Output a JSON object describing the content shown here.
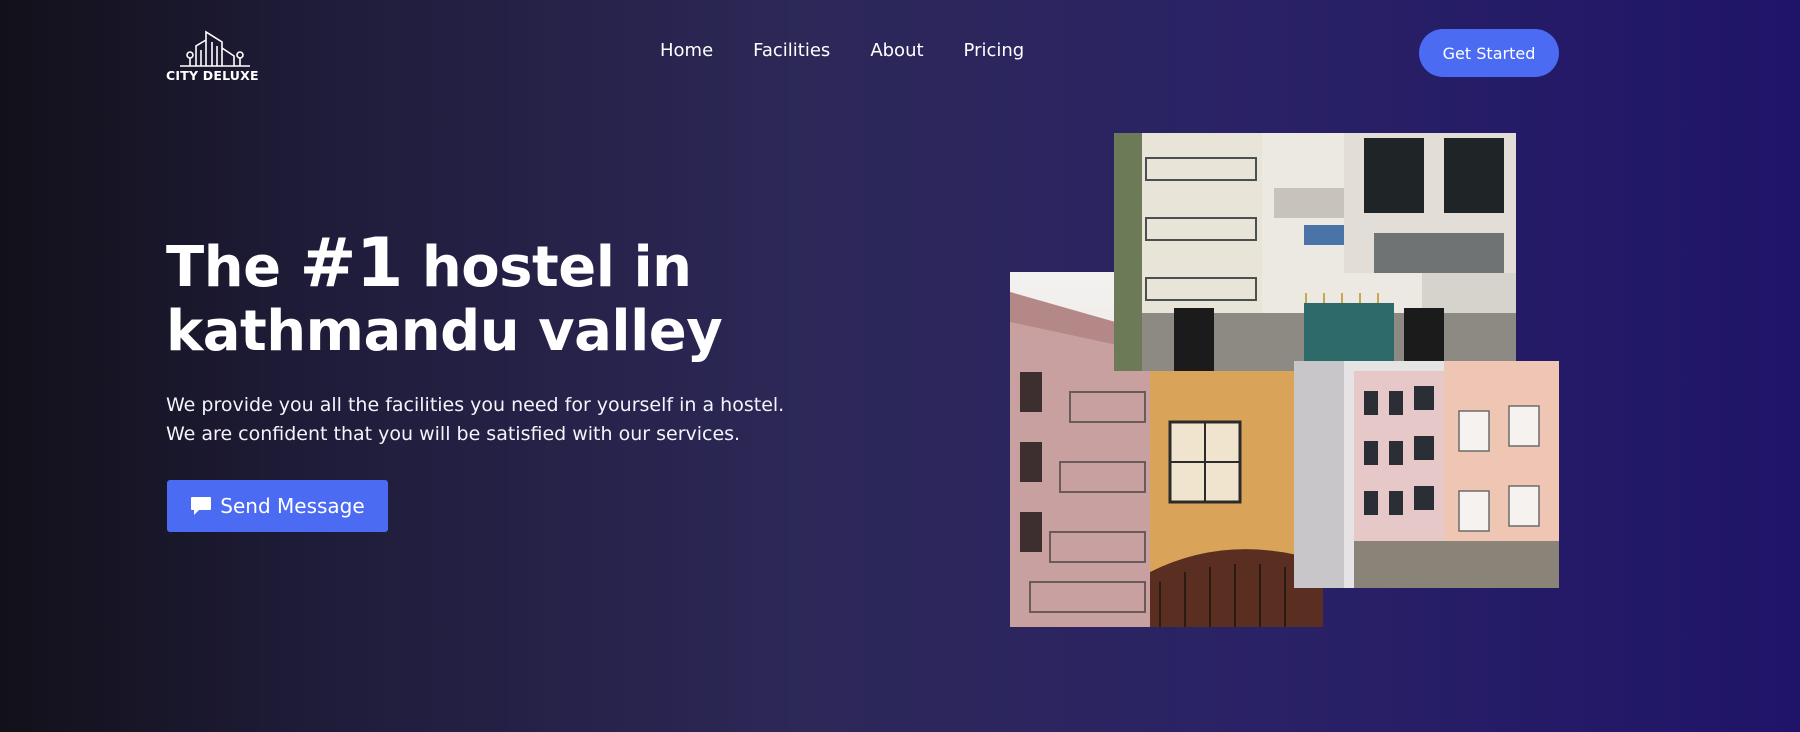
{
  "brand": {
    "name": "CITY DELUXE",
    "logo_icon": "city-buildings-icon"
  },
  "nav": {
    "items": [
      {
        "label": "Home"
      },
      {
        "label": "Facilities"
      },
      {
        "label": "About"
      },
      {
        "label": "Pricing"
      }
    ]
  },
  "header": {
    "cta_label": "Get Started"
  },
  "hero": {
    "title_prefix": "The",
    "title_highlight": "#1",
    "title_rest": "hostel in",
    "title_line2": "kathmandu valley",
    "subtitle_line1": "We provide you all the facilities you need for yourself in a hostel.",
    "subtitle_line2": "We are confident that you will be satisfied with our services.",
    "send_button_label": "Send Message",
    "send_button_icon": "chat-bubble-icon"
  },
  "colors": {
    "accent": "#4b6bf3",
    "background_start": "#121119",
    "background_end": "#1f1468"
  }
}
